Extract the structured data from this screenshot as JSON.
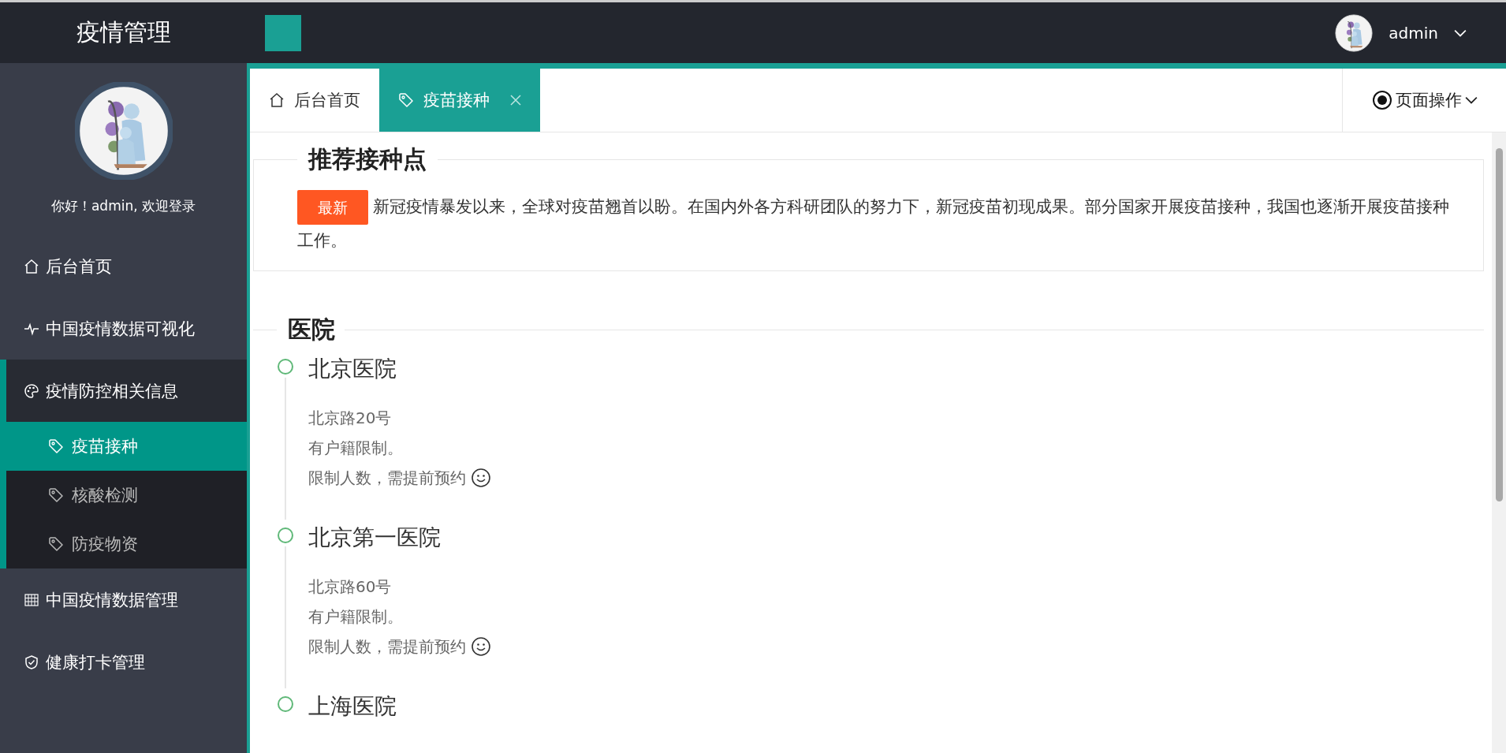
{
  "header": {
    "title": "疫情管理",
    "user": "admin"
  },
  "sidebar": {
    "greeting": "你好！admin, 欢迎登录",
    "items": [
      {
        "label": "后台首页",
        "kind": "home",
        "selected": false
      },
      {
        "label": "中国疫情数据可视化",
        "kind": "chart",
        "selected": false
      },
      {
        "label": "疫情防控相关信息",
        "kind": "info",
        "selected": false,
        "expanded": true,
        "children": [
          {
            "label": "疫苗接种",
            "kind": "page",
            "selected": true
          },
          {
            "label": "核酸检测",
            "kind": "page",
            "selected": false
          },
          {
            "label": "防疫物资",
            "kind": "page",
            "selected": false
          }
        ]
      },
      {
        "label": "中国疫情数据管理",
        "kind": "table",
        "selected": false
      },
      {
        "label": "健康打卡管理",
        "kind": "health",
        "selected": false
      }
    ]
  },
  "tabs": [
    {
      "label": "后台首页",
      "kind": "home",
      "selected": false,
      "closable": false
    },
    {
      "label": "疫苗接种",
      "kind": "page",
      "selected": true,
      "closable": true
    }
  ],
  "page_ops": "页面操作",
  "notice": {
    "title": "推荐接种点",
    "badge": "最新",
    "text": "新冠疫情暴发以来，全球对疫苗翘首以盼。在国内外各方科研团队的努力下，新冠疫苗初现成果。部分国家开展疫苗接种，我国也逐渐开展疫苗接种工作。"
  },
  "hospitals": {
    "title": "医院",
    "items": [
      {
        "name": "北京医院",
        "address": "北京路20号",
        "note": "有户籍限制。",
        "limit": "限制人数，需提前预约"
      },
      {
        "name": "北京第一医院",
        "address": "北京路60号",
        "note": "有户籍限制。",
        "limit": "限制人数，需提前预约"
      },
      {
        "name": "上海医院"
      }
    ]
  }
}
